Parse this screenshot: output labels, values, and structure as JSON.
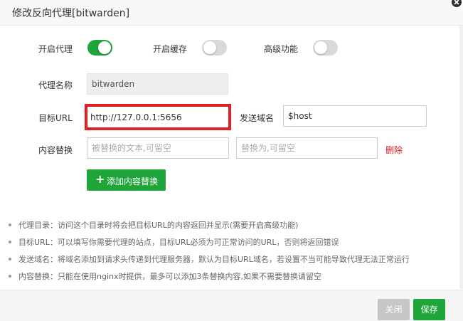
{
  "dialog": {
    "title": "修改反向代理[bitwarden]"
  },
  "toggles": {
    "proxy": {
      "label": "开启代理",
      "state": "on"
    },
    "cache": {
      "label": "开启缓存",
      "state": "off"
    },
    "advanced": {
      "label": "高级功能",
      "state": "off"
    }
  },
  "form": {
    "proxy_name": {
      "label": "代理名称",
      "value": "bitwarden"
    },
    "target_url": {
      "label": "目标URL",
      "value": "http://127.0.0.1:5656"
    },
    "send_domain": {
      "label": "发送域名",
      "value": "$host"
    },
    "content_replace": {
      "label": "内容替换",
      "from_placeholder": "被替换的文本,可留空",
      "to_placeholder": "替换为,可留空",
      "delete_label": "删除"
    },
    "add_replace_label": "添加内容替换"
  },
  "tips": [
    "代理目录：访问这个目录时将会把目标URL的内容返回并显示(需要开启高级功能)",
    "目标URL：可以填写你需要代理的站点，目标URL必须为可正常访问的URL，否则将返回错误",
    "发送域名：将域名添加到请求头传递到代理服务器，默认为目标URL域名，若设置不当可能导致代理无法正常运行",
    "内容替换：只能在使用nginx时提供，最多可以添加3条替换内容,如果不需要替换请留空"
  ],
  "footer": {
    "close_label": "关闭",
    "save_label": "保存"
  },
  "colors": {
    "accent": "#20a53a",
    "highlight": "#e02020",
    "delete": "#e02020"
  }
}
